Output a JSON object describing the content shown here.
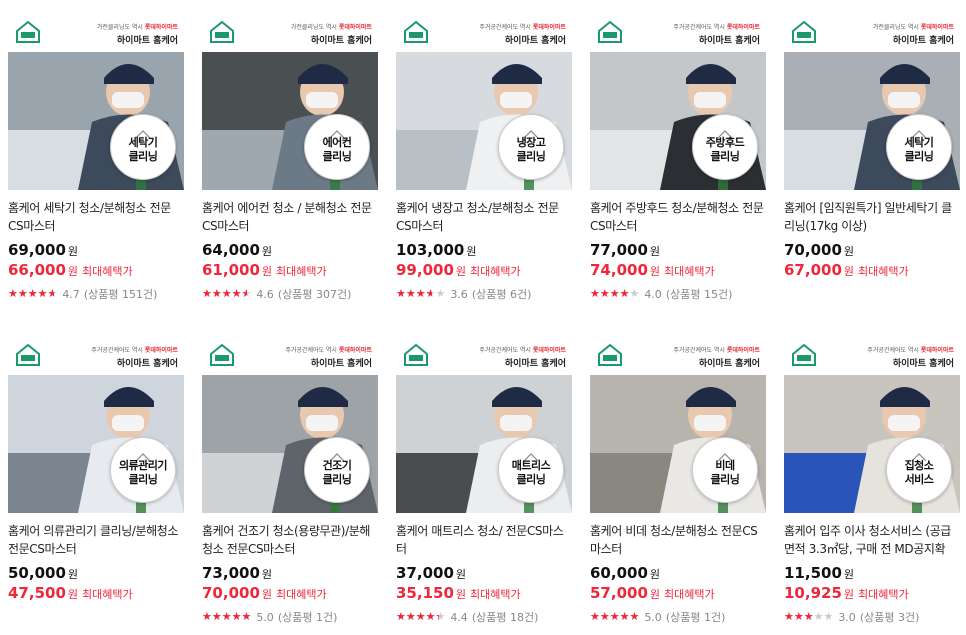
{
  "banner": {
    "line1_prefix": "가전클리닝도 역시",
    "line1_prefix_alt": "주거공간케어도 역시",
    "line1_highlight": "롯데하이마트",
    "line2": "하이마트 홈케어",
    "logo_text": "홈케어"
  },
  "currency": "원",
  "benefit_label": "최대혜택가",
  "review_prefix": "상품평",
  "review_suffix": "건",
  "colors": {
    "accent": "#f0263a",
    "logo_green": "#1a9a6b"
  },
  "products": [
    {
      "banner_alt": false,
      "badge": [
        "세탁기",
        "클리닝"
      ],
      "title": "홈케어 세탁기 청소/분해청소 전문CS마스터",
      "price": "69,000",
      "sale": "66,000",
      "rating": 4.7,
      "rating_text": "4.7",
      "reviews": "151",
      "has_rating": true
    },
    {
      "banner_alt": false,
      "badge": [
        "에어컨",
        "클리닝"
      ],
      "title": "홈케어 에어컨 청소 / 분해청소 전문CS마스터",
      "price": "64,000",
      "sale": "61,000",
      "rating": 4.6,
      "rating_text": "4.6",
      "reviews": "307",
      "has_rating": true
    },
    {
      "banner_alt": true,
      "badge": [
        "냉장고",
        "클리닝"
      ],
      "title": "홈케어 냉장고 청소/분해청소 전문CS마스터",
      "price": "103,000",
      "sale": "99,000",
      "rating": 3.6,
      "rating_text": "3.6",
      "reviews": "6",
      "has_rating": true
    },
    {
      "banner_alt": true,
      "badge": [
        "주방후드",
        "클리닝"
      ],
      "title": "홈케어 주방후드 청소/분해청소 전문CS마스터",
      "price": "77,000",
      "sale": "74,000",
      "rating": 4.0,
      "rating_text": "4.0",
      "reviews": "15",
      "has_rating": true
    },
    {
      "banner_alt": false,
      "badge": [
        "세탁기",
        "클리닝"
      ],
      "title": "홈케어 [임직원특가] 일반세탁기 클리닝(17kg 이상)",
      "price": "70,000",
      "sale": "67,000",
      "rating": 0,
      "rating_text": "",
      "reviews": "",
      "has_rating": false
    },
    {
      "banner_alt": true,
      "badge": [
        "의류관리기",
        "클리닝"
      ],
      "title": "홈케어 의류관리기 클리닝/분해청소 전문CS마스터",
      "price": "50,000",
      "sale": "47,500",
      "rating": 0,
      "rating_text": "",
      "reviews": "",
      "has_rating": false
    },
    {
      "banner_alt": true,
      "badge": [
        "건조기",
        "클리닝"
      ],
      "title": "홈케어 건조기 청소(용량무관)/분해청소 전문CS마스터",
      "price": "73,000",
      "sale": "70,000",
      "rating": 5.0,
      "rating_text": "5.0",
      "reviews": "1",
      "has_rating": true
    },
    {
      "banner_alt": true,
      "badge": [
        "매트리스",
        "클리닝"
      ],
      "title": "홈케어 매트리스 청소/ 전문CS마스터",
      "price": "37,000",
      "sale": "35,150",
      "rating": 4.4,
      "rating_text": "4.4",
      "reviews": "18",
      "has_rating": true
    },
    {
      "banner_alt": true,
      "badge": [
        "비데",
        "클리닝"
      ],
      "title": "홈케어 비데 청소/분해청소 전문CS마스터",
      "price": "60,000",
      "sale": "57,000",
      "rating": 5.0,
      "rating_text": "5.0",
      "reviews": "1",
      "has_rating": true
    },
    {
      "banner_alt": true,
      "badge": [
        "집청소",
        "서비스"
      ],
      "title": "홈케어 입주 이사 청소서비스 (공급면적 3.3㎡당, 구매 전 MD공지확인!)",
      "price": "11,500",
      "sale": "10,925",
      "rating": 3.0,
      "rating_text": "3.0",
      "reviews": "3",
      "has_rating": true
    }
  ]
}
